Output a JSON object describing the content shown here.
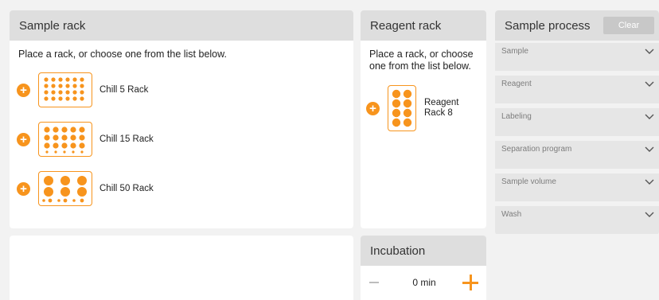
{
  "sample_rack": {
    "title": "Sample rack",
    "instruction": "Place a rack, or choose one from the list below.",
    "racks": [
      {
        "label": "Chill 5 Rack"
      },
      {
        "label": "Chill 15 Rack"
      },
      {
        "label": "Chill 50 Rack"
      }
    ]
  },
  "reagent_rack": {
    "title": "Reagent rack",
    "instruction": "Place a rack, or choose one from the list below.",
    "racks": [
      {
        "label": "Reagent Rack 8"
      }
    ]
  },
  "incubation": {
    "title": "Incubation",
    "value": "0 min"
  },
  "sample_process": {
    "title": "Sample process",
    "clear_label": "Clear",
    "items": [
      {
        "label": "Sample"
      },
      {
        "label": "Reagent"
      },
      {
        "label": "Labeling"
      },
      {
        "label": "Separation program"
      },
      {
        "label": "Sample volume"
      },
      {
        "label": "Wash"
      }
    ]
  },
  "colors": {
    "accent": "#f7941d",
    "header_bg": "#dedede",
    "item_bg": "#e6e6e6",
    "page_bg": "#f2f2f2"
  },
  "icons": [
    "add-circle-icon",
    "rack-thumbnail-icon",
    "minus-icon",
    "plus-icon",
    "chevron-down-icon"
  ]
}
